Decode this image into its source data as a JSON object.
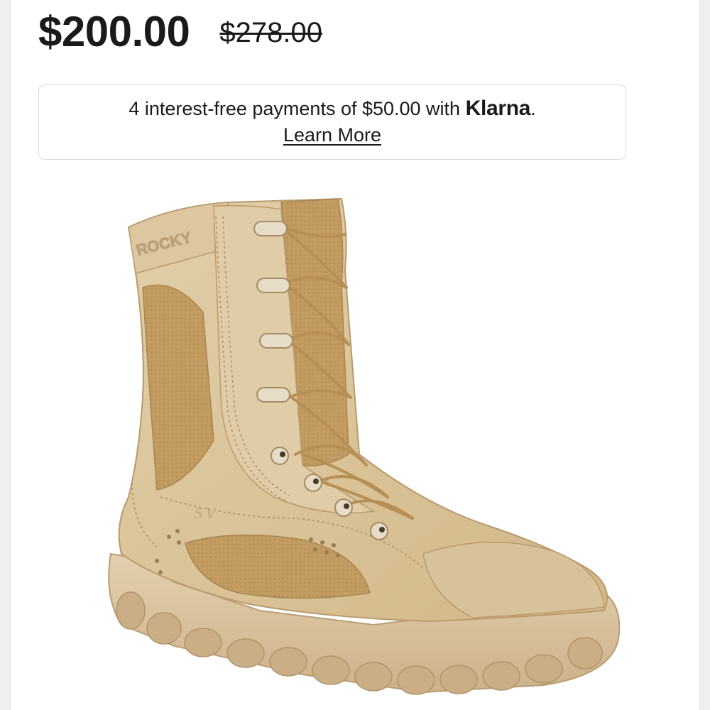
{
  "pricing": {
    "current_price": "$200.00",
    "original_price": "$278.00"
  },
  "klarna": {
    "text_before": "4 interest-free payments of $50.00 with ",
    "brand": "Klarna",
    "text_after": ".",
    "link_label": "Learn More"
  },
  "product": {
    "brand_marking": "ROCKY",
    "model_marking": "S V",
    "colors": {
      "upper": "#d8c29a",
      "nylon": "#c7a06a",
      "sole": "#dcc6a4"
    }
  }
}
